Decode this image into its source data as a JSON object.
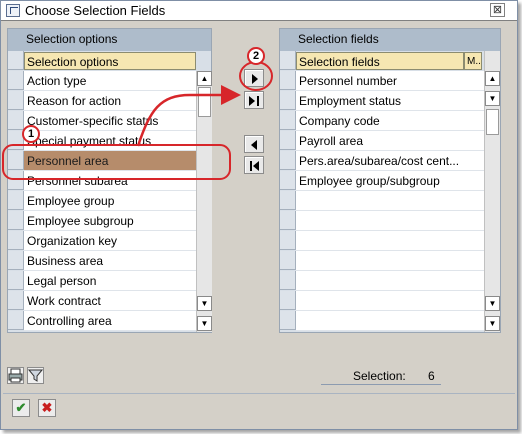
{
  "window": {
    "title": "Choose Selection Fields",
    "close_glyph": "⊠"
  },
  "left_panel": {
    "header": "Selection options",
    "column_header": "Selection options",
    "items": [
      "Action type",
      "Reason for action",
      "Customer-specific status",
      "Special payment status",
      "Personnel area",
      "Personnel subarea",
      "Employee group",
      "Employee subgroup",
      "Organization key",
      "Business area",
      "Legal person",
      "Work contract",
      "Controlling area"
    ],
    "highlighted_item": "Personnel area"
  },
  "right_panel": {
    "header": "Selection fields",
    "column_header": "Selection fields",
    "column_header_m": "M..",
    "items": [
      "Personnel number",
      "Employment status",
      "Company code",
      "Payroll area",
      "Pers.area/subarea/cost cent...",
      "Employee group/subgroup"
    ]
  },
  "footer": {
    "selection_label": "Selection:",
    "selection_value": "6"
  },
  "callouts": {
    "one": "1",
    "two": "2"
  },
  "colors": {
    "highlight": "#b68c6b",
    "annotation_red": "#d7262a",
    "panel_header": "#aebccb"
  },
  "icons": {
    "move_right": "triangle-right-icon",
    "move_all_right": "triangle-right-bar-icon",
    "move_left": "triangle-left-icon",
    "move_all_left": "triangle-left-bar-icon",
    "ok": "check-icon",
    "cancel": "x-icon"
  }
}
